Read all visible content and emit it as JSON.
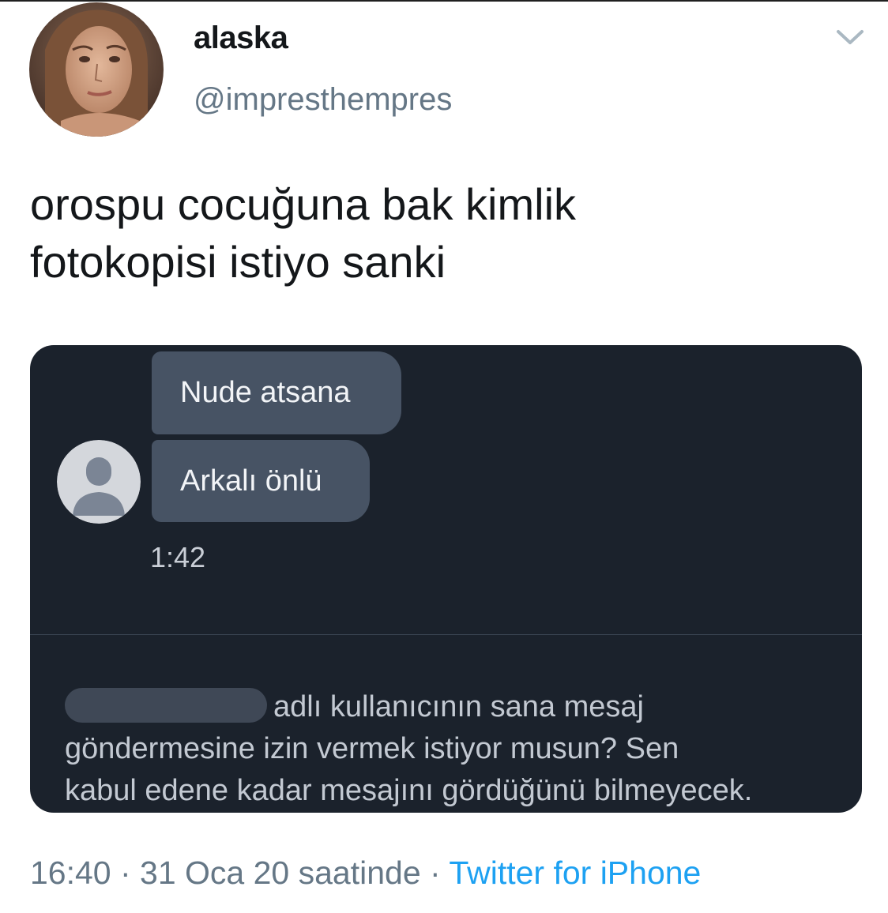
{
  "tweet": {
    "display_name": "alaska",
    "handle": "@impresthempres",
    "text_lines": [
      "orospu cocuğuna bak kimlik",
      "fotokopisi istiyo sanki"
    ],
    "timestamp": "16:40 · 31 Oca 20 saatinde · ",
    "source": "Twitter for iPhone",
    "menu_icon": "chevron-down-icon"
  },
  "media": {
    "messages": [
      "Nude atsana",
      "Arkalı önlü"
    ],
    "message_time": "1:42",
    "sender_avatar_icon": "default-user-icon",
    "request_lines": [
      "adlı kullanıcının sana mesaj",
      "göndermesine izin vermek istiyor musun? Sen",
      "kabul edene kadar mesajını gördüğünü bilmeyecek."
    ]
  },
  "colors": {
    "link": "#1da1f2",
    "secondary_text": "#657786",
    "media_background": "#1b222c",
    "bubble": "#475364"
  }
}
